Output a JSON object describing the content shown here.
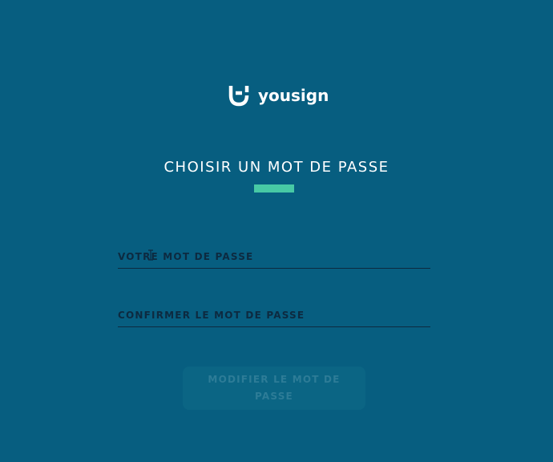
{
  "brand": {
    "icon": "yousign-logo-icon",
    "name": "yousign"
  },
  "page": {
    "title": "CHOISIR UN MOT DE PASSE"
  },
  "form": {
    "password": {
      "value": "",
      "placeholder": "VOTRE MOT DE PASSE"
    },
    "confirm_password": {
      "value": "",
      "placeholder": "CONFIRMER LE MOT DE PASSE"
    },
    "submit_label": "MODIFIER LE MOT DE PASSE",
    "submit_enabled": false
  },
  "colors": {
    "background": "#075e80",
    "accent": "#47c9a5",
    "field_text": "#0d2a40",
    "button_disabled_bg": "#0b6584",
    "button_disabled_text": "#2d7c97"
  }
}
